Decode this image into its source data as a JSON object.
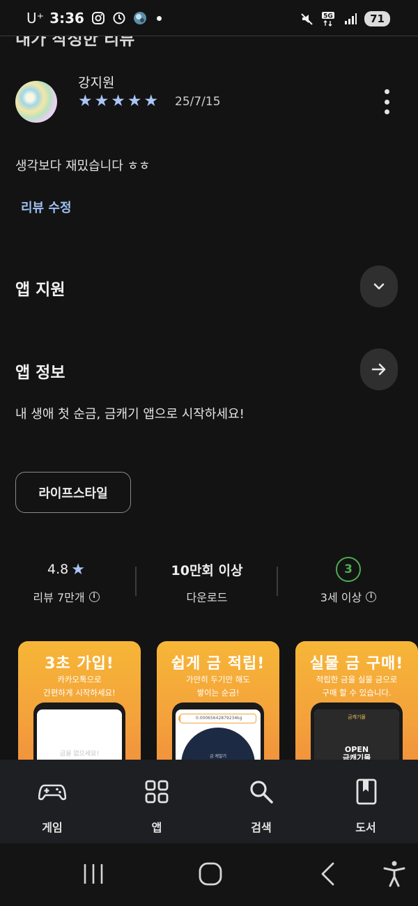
{
  "status_bar": {
    "carrier": "U⁺",
    "time": "3:36",
    "network": "5G",
    "battery": "71",
    "icons": [
      "instagram-icon",
      "clock-icon",
      "app-avatar-icon",
      "notification-dot",
      "mute-icon",
      "5g-icon",
      "signal-icon",
      "battery-icon"
    ]
  },
  "review": {
    "section_title": "내가 작성한 리뷰",
    "reviewer_name": "강지원",
    "rating": 5,
    "stars": [
      "★",
      "★",
      "★",
      "★",
      "★"
    ],
    "date": "25/7/15",
    "text": "생각보다 재밌습니다 ㅎㅎ",
    "edit_label": "리뷰 수정"
  },
  "app_support": {
    "title": "앱 지원",
    "icon": "chevron-down-icon"
  },
  "app_info": {
    "title": "앱 정보",
    "icon": "arrow-right-icon",
    "description": "내 생애 첫 순금, 금캐기 앱으로 시작하세요!",
    "category_chip": "라이프스타일"
  },
  "stats": {
    "rating_value": "4.8",
    "rating_star": "★",
    "rating_label": "리뷰 7만개",
    "downloads_value": "10만회 이상",
    "downloads_label": "다운로드",
    "age_value": "3",
    "age_label": "3세 이상",
    "info_glyph": "i"
  },
  "screenshots": [
    {
      "title": "3초 가입!",
      "subtitle": "카카오톡으로\n간편하게 시작하세요!",
      "screen_text": "금을 없으세요!"
    },
    {
      "title": "쉽게 금 적립!",
      "subtitle": "가만히 두기만 해도\n쌓이는 순금!",
      "screen_bar": "0.00065642879234kg",
      "screen_label": "금 캐발기"
    },
    {
      "title": "실물 금 구매!",
      "subtitle": "적립한 금을 실물 금으로\n구매 할 수 있습니다.",
      "screen_top": "금캐기몰",
      "screen_text": "OPEN\n금캐기몰"
    }
  ],
  "bottom_nav": [
    {
      "label": "게임",
      "icon": "gamepad-icon"
    },
    {
      "label": "앱",
      "icon": "apps-grid-icon"
    },
    {
      "label": "검색",
      "icon": "search-icon"
    },
    {
      "label": "도서",
      "icon": "book-icon"
    }
  ],
  "system_nav": [
    "recent-apps-icon",
    "home-icon",
    "back-icon",
    "accessibility-icon"
  ],
  "colors": {
    "background": "#131313",
    "accent_blue": "#a9c6f5",
    "link_blue": "#9ebff2",
    "age_green": "#4cae4f",
    "screenshot_orange": "#f4a33b"
  }
}
